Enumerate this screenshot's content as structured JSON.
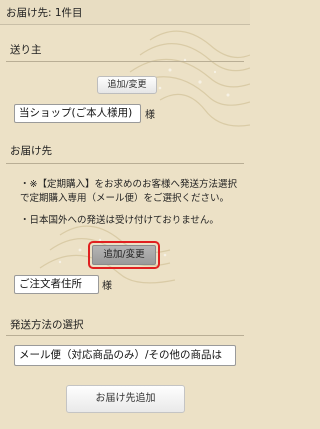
{
  "header": {
    "title": "お届け先: 1件目"
  },
  "sender": {
    "heading": "送り主",
    "change_button": "追加/変更",
    "selected": "当ショップ(ご本人様用)",
    "suffix": "様"
  },
  "delivery": {
    "heading": "お届け先",
    "notes": [
      "・※【定期購入】をお求めのお客様へ発送方法選択で定期購入専用（メール便）をご選択ください。",
      "・日本国外への発送は受け付けておりません。"
    ],
    "change_button": "追加/変更",
    "selected": "ご注文者住所",
    "suffix": "様"
  },
  "shipping": {
    "heading": "発送方法の選択",
    "selected": "メール便（対応商品のみ）/その他の商品は"
  },
  "footer": {
    "add_destination_button": "お届け先追加"
  }
}
